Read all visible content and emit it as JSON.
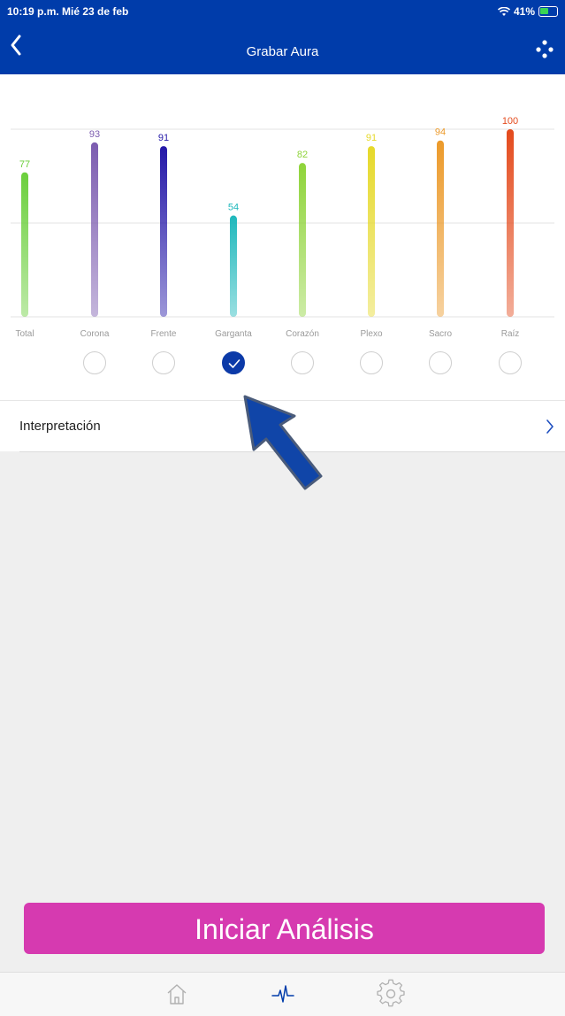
{
  "status_bar": {
    "time_date": "10:19 p.m.  Mié 23 de feb",
    "battery": "41%"
  },
  "nav": {
    "title": "Grabar Aura",
    "back_icon": "chevron-left-icon",
    "more_icon": "dots-icon"
  },
  "chart_data": {
    "type": "bar",
    "categories": [
      "Total",
      "Corona",
      "Frente",
      "Garganta",
      "Corazón",
      "Plexo",
      "Sacro",
      "Raíz"
    ],
    "values": [
      77,
      93,
      91,
      54,
      82,
      91,
      94,
      100
    ],
    "colors": [
      "#6bcf3c",
      "#7c5cb0",
      "#2418a8",
      "#1fb8bc",
      "#8fd43a",
      "#e6d92a",
      "#ec9a2a",
      "#e44a1c"
    ],
    "ylim": [
      0,
      100
    ],
    "selected_index": 3
  },
  "interpretation": {
    "label": "Interpretación",
    "chevron_icon": "chevron-right-icon"
  },
  "start_button": {
    "label": "Iniciar Análisis"
  },
  "tab_bar": {
    "items": [
      {
        "icon": "home-icon"
      },
      {
        "icon": "heartbeat-icon",
        "active": true
      },
      {
        "icon": "gear-icon"
      }
    ],
    "active_color": "#003caa",
    "inactive_color": "#b0b0b0"
  }
}
